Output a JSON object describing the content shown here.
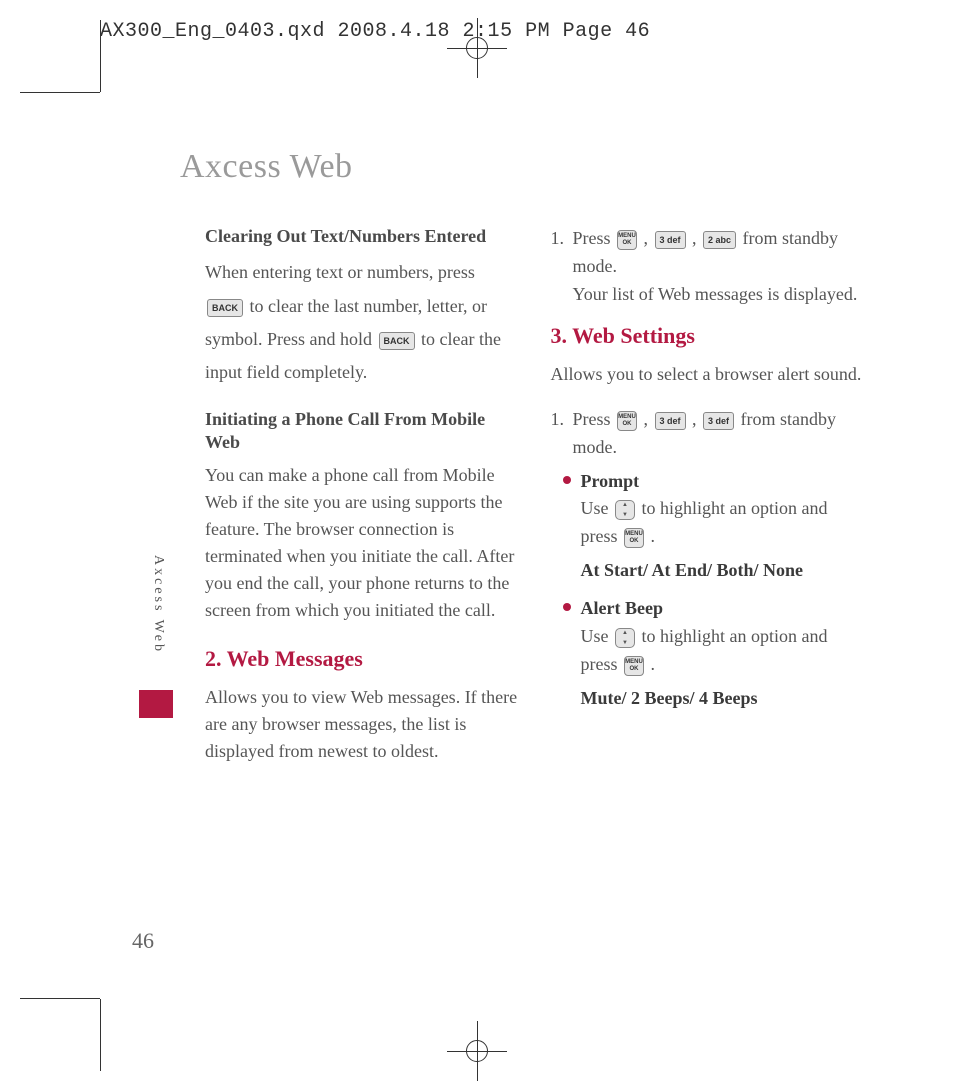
{
  "printHeader": "AX300_Eng_0403.qxd  2008.4.18  2:15 PM  Page 46",
  "pageTitle": "Axcess Web",
  "sideLabel": "Axcess Web",
  "pageNumber": "46",
  "keys": {
    "back": "BACK",
    "okTop": "MENU",
    "okBottom": "OK",
    "k3": "3 def",
    "k2": "2 abc"
  },
  "col1": {
    "sub1": "Clearing Out Text/Numbers Entered",
    "p1a": "When entering text or numbers, press ",
    "p1b": " to clear the last number, letter, or symbol. Press and hold ",
    "p1c": " to clear the input field completely.",
    "sub2": "Initiating a Phone Call From Mobile Web",
    "p2": "You can make a phone call from Mobile Web if the site you are using supports the feature. The browser connection is terminated when you initiate the call. After you end the call, your phone returns to the screen from which you initiated the call.",
    "sec2": "2. Web Messages",
    "p3": "Allows you to view Web messages. If there are any browser messages, the list is displayed from newest to oldest."
  },
  "col2": {
    "s1num": "1.",
    "s1a": "Press ",
    "s1b": " , ",
    "s1c": " , ",
    "s1d": " from standby mode.",
    "s1e": "Your list of Web messages is displayed.",
    "sec3": "3. Web Settings",
    "p4": "Allows you to select a browser alert sound.",
    "s2num": "1.",
    "s2a": "Press ",
    "s2b": " , ",
    "s2c": " , ",
    "s2d": " from standby mode.",
    "b1title": "Prompt",
    "b1a": "Use ",
    "b1b": " to highlight an option and press ",
    "b1c": " .",
    "opts1": "At Start/ At End/ Both/ None",
    "b2title": "Alert Beep",
    "b2a": "Use ",
    "b2b": " to highlight an option and press ",
    "b2c": " .",
    "opts2": "Mute/ 2 Beeps/ 4 Beeps"
  }
}
